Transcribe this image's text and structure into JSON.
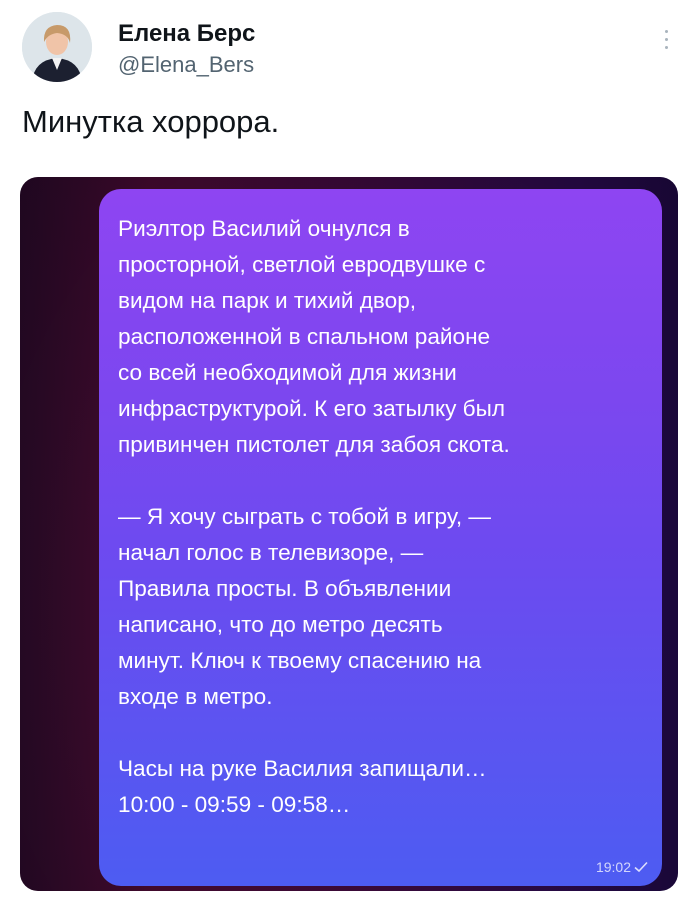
{
  "tweet": {
    "author_name": "Елена Берс",
    "author_handle": "@Elena_Bers",
    "text": "Минутка хоррора."
  },
  "media": {
    "message": {
      "paragraphs": [
        "Риэлтор Василий очнулся в\nпросторной, светлой евродвушке с\nвидом на парк и тихий двор,\nрасположенной в спальном районе\nсо всей необходимой для жизни\nинфраструктурой. К его затылку был\nпривинчен пистолет для забоя скота.",
        "— Я хочу сыграть с тобой в игру, —\nначал голос в телевизоре, —\nПравила просты. В объявлении\nнаписано, что до метро десять\nминут. Ключ к твоему спасению на\nвходе в метро.",
        "Часы на руке Василия запищали…\n10:00 - 09:59 - 09:58…"
      ],
      "time": "19:02",
      "status_icon": "check-icon"
    }
  },
  "icons": {
    "more": "more-vertical-icon",
    "avatar": "avatar"
  },
  "colors": {
    "bubble_top": "#8e45f2",
    "bubble_bottom": "#4d5cf2",
    "background_dark": "#2a0b26",
    "handle_gray": "#536471"
  }
}
